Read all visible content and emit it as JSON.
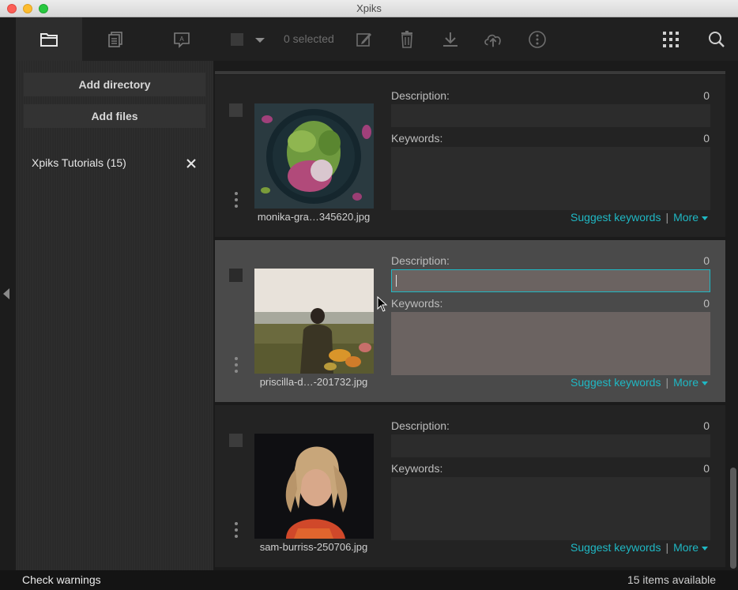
{
  "window": {
    "title": "Xpiks"
  },
  "toolbar": {
    "tabs": [
      {
        "icon": "folder-icon",
        "active": true
      },
      {
        "icon": "documents-icon",
        "active": false
      },
      {
        "icon": "image-text-icon",
        "active": false
      }
    ],
    "selected_label": "0 selected",
    "actions": [
      "edit-icon",
      "trash-icon",
      "download-icon",
      "cloud-upload-icon",
      "more-icon"
    ],
    "right_icons": [
      "grid-icon",
      "search-icon"
    ]
  },
  "sidebar": {
    "add_directory": "Add directory",
    "add_files": "Add files",
    "directories": [
      {
        "label": "Xpiks Tutorials (15)"
      }
    ]
  },
  "items": [
    {
      "filename": "monika-gra…345620.jpg",
      "description_label": "Description:",
      "description_count": "0",
      "description_value": "",
      "keywords_label": "Keywords:",
      "keywords_count": "0",
      "suggest_label": "Suggest keywords",
      "separator": "|",
      "more_label": "More",
      "selected": false
    },
    {
      "filename": "priscilla-d…-201732.jpg",
      "description_label": "Description:",
      "description_count": "0",
      "description_value": "",
      "keywords_label": "Keywords:",
      "keywords_count": "0",
      "suggest_label": "Suggest keywords",
      "separator": "|",
      "more_label": "More",
      "selected": true
    },
    {
      "filename": "sam-burriss-250706.jpg",
      "description_label": "Description:",
      "description_count": "0",
      "description_value": "",
      "keywords_label": "Keywords:",
      "keywords_count": "0",
      "suggest_label": "Suggest keywords",
      "separator": "|",
      "more_label": "More",
      "selected": false
    }
  ],
  "status": {
    "warnings_label": "Check warnings",
    "items_available": "15 items available"
  },
  "colors": {
    "accent": "#1fb8c4",
    "background": "#262626",
    "selected_row": "#4a4a4a"
  }
}
